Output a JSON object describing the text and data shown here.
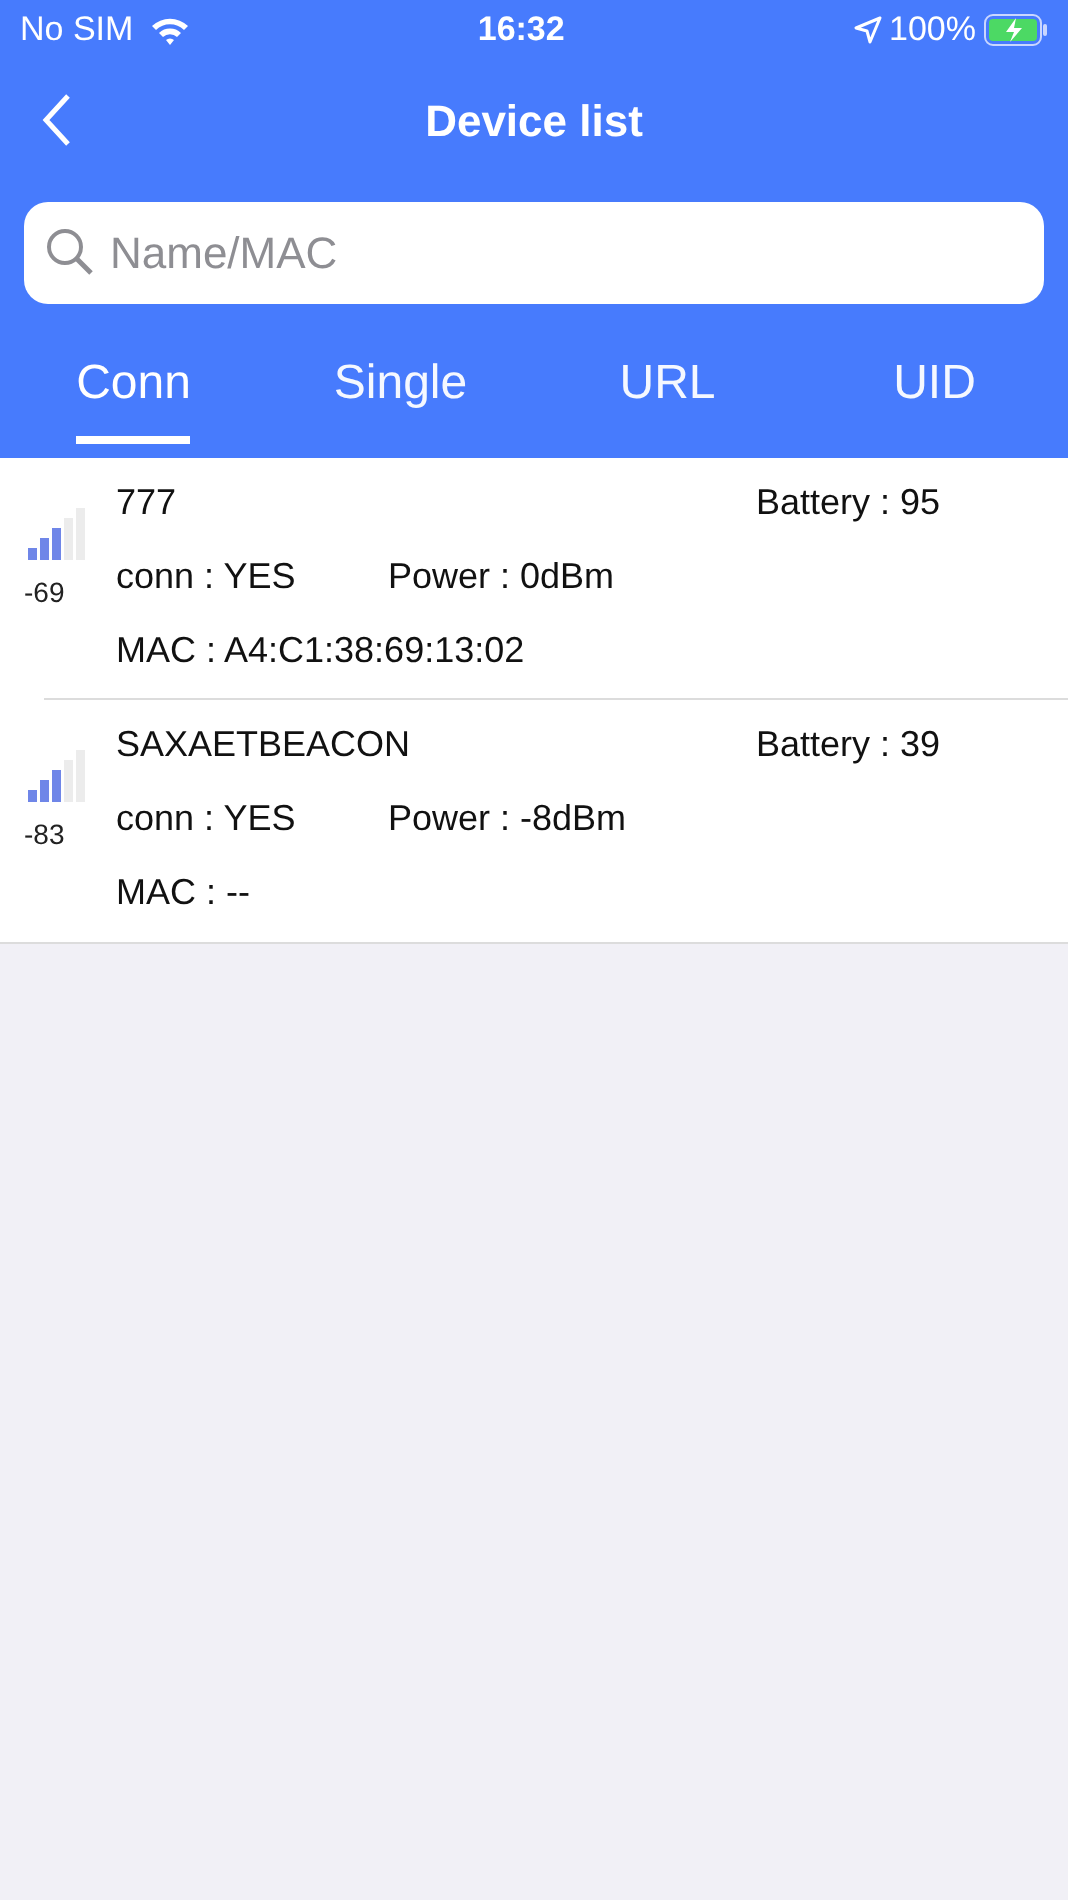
{
  "status_bar": {
    "carrier": "No SIM",
    "time": "16:32",
    "battery": "100%"
  },
  "header": {
    "title": "Device list"
  },
  "search": {
    "placeholder": "Name/MAC"
  },
  "tabs": [
    {
      "label": "Conn",
      "selected": true
    },
    {
      "label": "Single",
      "selected": false
    },
    {
      "label": "URL",
      "selected": false
    },
    {
      "label": "UID",
      "selected": false
    }
  ],
  "devices": [
    {
      "rssi": "-69",
      "name": "777",
      "battery": "Battery : 95",
      "conn": "conn : YES",
      "power": "Power : 0dBm",
      "mac": "MAC : A4:C1:38:69:13:02"
    },
    {
      "rssi": "-83",
      "name": "SAXAETBEACON",
      "battery": "Battery : 39",
      "conn": "conn : YES",
      "power": "Power : -8dBm",
      "mac": "MAC : --"
    }
  ]
}
